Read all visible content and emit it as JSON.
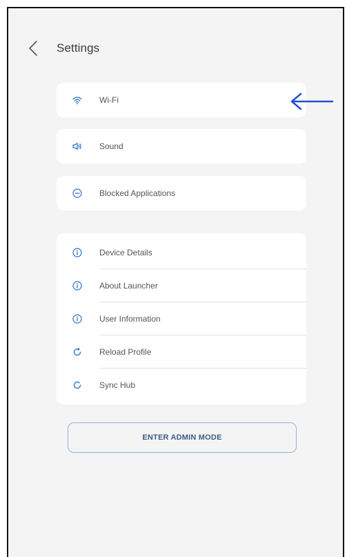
{
  "header": {
    "title": "Settings",
    "back_icon": "chevron-left-icon"
  },
  "cards": {
    "wifi": {
      "label": "Wi-Fi",
      "icon": "wifi-icon"
    },
    "sound": {
      "label": "Sound",
      "icon": "speaker-icon"
    },
    "blocked": {
      "label": "Blocked Applications",
      "icon": "minus-circle-icon"
    }
  },
  "group": {
    "items": [
      {
        "label": "Device Details",
        "icon": "info-icon"
      },
      {
        "label": "About Launcher",
        "icon": "info-icon"
      },
      {
        "label": "User Information",
        "icon": "info-icon"
      },
      {
        "label": "Reload Profile",
        "icon": "refresh-icon"
      },
      {
        "label": "Sync Hub",
        "icon": "sync-icon"
      }
    ]
  },
  "admin_button": {
    "label": "ENTER ADMIN MODE"
  },
  "annotation": {
    "arrow_color": "#2250d6"
  },
  "colors": {
    "accent": "#2a6fc9",
    "background": "#f4f4f5",
    "card": "#ffffff"
  }
}
